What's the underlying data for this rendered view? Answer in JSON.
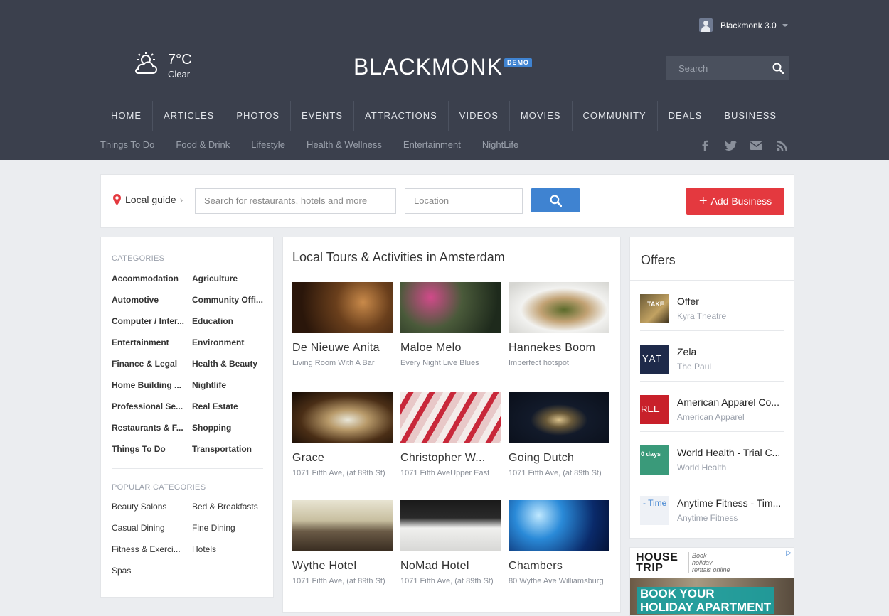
{
  "header": {
    "user_name": "Blackmonk 3.0",
    "weather": {
      "temp": "7°C",
      "condition": "Clear",
      "icon": "partly-cloudy-icon"
    },
    "logo": {
      "text": "BLACKMONK",
      "badge": "DEMO"
    },
    "search_placeholder": "Search",
    "main_nav": [
      "HOME",
      "ARTICLES",
      "PHOTOS",
      "EVENTS",
      "ATTRACTIONS",
      "VIDEOS",
      "MOVIES",
      "COMMUNITY",
      "DEALS",
      "BUSINESS"
    ],
    "sub_nav": [
      "Things To Do",
      "Food & Drink",
      "Lifestyle",
      "Health & Wellness",
      "Entertainment",
      "NightLife"
    ],
    "social": [
      "facebook-icon",
      "twitter-icon",
      "mail-icon",
      "rss-icon"
    ]
  },
  "guide": {
    "label": "Local guide",
    "search_placeholder": "Search for restaurants, hotels and more",
    "location_placeholder": "Location",
    "add_business": "Add Business"
  },
  "categories": {
    "heading": "CATEGORIES",
    "items": [
      "Accommodation",
      "Agriculture",
      "Automotive",
      "Community Offi...",
      "Computer / Inter...",
      "Education",
      "Entertainment",
      "Environment",
      "Finance & Legal",
      "Health & Beauty",
      "Home Building ...",
      "Nightlife",
      "Professional Se...",
      "Real Estate",
      "Restaurants & F...",
      "Shopping",
      "Things To Do",
      "Transportation"
    ],
    "popular_heading": "POPULAR CATEGORIES",
    "popular": [
      "Beauty Salons",
      "Bed & Breakfasts",
      "Casual Dining",
      "Fine Dining",
      "Fitness & Exerci...",
      "Hotels",
      "Spas"
    ]
  },
  "tours": {
    "title": "Local Tours & Activities in Amsterdam",
    "items": [
      {
        "name": "De Nieuwe Anita",
        "desc": "Living Room With A Bar"
      },
      {
        "name": "Maloe Melo",
        "desc": "Every Night Live Blues"
      },
      {
        "name": "Hannekes Boom",
        "desc": "Imperfect hotspot"
      },
      {
        "name": "Grace",
        "desc": "1071 Fifth Ave, (at 89th St)"
      },
      {
        "name": "Christopher W...",
        "desc": "1071 Fifth AveUpper East"
      },
      {
        "name": "Going Dutch",
        "desc": "1071 Fifth Ave, (at 89th St)"
      },
      {
        "name": "Wythe Hotel",
        "desc": "1071 Fifth Ave, (at 89th St)"
      },
      {
        "name": "NoMad Hotel",
        "desc": "1071 Fifth Ave, (at 89th St)"
      },
      {
        "name": "Chambers",
        "desc": "80 Wythe Ave Williamsburg"
      }
    ]
  },
  "offers": {
    "title": "Offers",
    "items": [
      {
        "title": "Offer",
        "sub": "Kyra Theatre",
        "thumb_text": "TAKE"
      },
      {
        "title": "Zela",
        "sub": "The Paul",
        "thumb_text": "YAT"
      },
      {
        "title": "American Apparel Co...",
        "sub": "American Apparel",
        "thumb_text": "REE"
      },
      {
        "title": "World Health - Trial C...",
        "sub": "World Health",
        "thumb_text": "0 days"
      },
      {
        "title": "Anytime Fitness - Tim...",
        "sub": "Anytime Fitness",
        "thumb_text": "- Time"
      }
    ]
  },
  "ad": {
    "brand_line1": "HOUSE",
    "brand_line2": "TRIP",
    "tagline_1": "Book",
    "tagline_2": "holiday",
    "tagline_3": "rentals online",
    "cta_line1": "BOOK YOUR",
    "cta_line2": "HOLIDAY APARTMENT"
  },
  "colors": {
    "header_bg": "#3b404d",
    "accent_blue": "#3f83d1",
    "accent_red": "#e4393f"
  }
}
